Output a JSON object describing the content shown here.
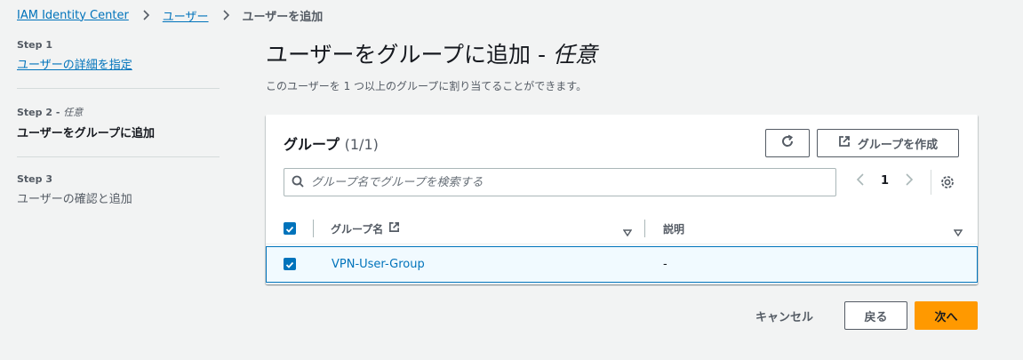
{
  "breadcrumb": {
    "root": "IAM Identity Center",
    "users": "ユーザー",
    "current": "ユーザーを追加"
  },
  "steps": [
    {
      "num": "Step 1",
      "title": "ユーザーの詳細を指定"
    },
    {
      "num": "Step 2 - ",
      "num_optional": "任意",
      "title": "ユーザーをグループに追加"
    },
    {
      "num": "Step 3",
      "title": "ユーザーの確認と追加"
    }
  ],
  "page": {
    "title": "ユーザーをグループに追加 - ",
    "title_optional": "任意",
    "description": "このユーザーを 1 つ以上のグループに割り当てることができます。"
  },
  "panel": {
    "title": "グループ",
    "count": "(1/1)",
    "create_label": "グループを作成",
    "search_placeholder": "グループ名でグループを検索する",
    "page_number": "1"
  },
  "table": {
    "columns": [
      "グループ名",
      "説明"
    ],
    "rows": [
      {
        "name": "VPN-User-Group",
        "description": "-",
        "selected": true
      }
    ]
  },
  "footer": {
    "cancel": "キャンセル",
    "back": "戻る",
    "next": "次へ"
  },
  "colors": {
    "link": "#0073bb",
    "primary": "#ff9900",
    "background": "#f2f3f3"
  },
  "icons": [
    "chevron-right-icon",
    "refresh-icon",
    "external-link-icon",
    "search-icon",
    "gear-icon",
    "sort-icon",
    "checkbox-checked-icon"
  ]
}
